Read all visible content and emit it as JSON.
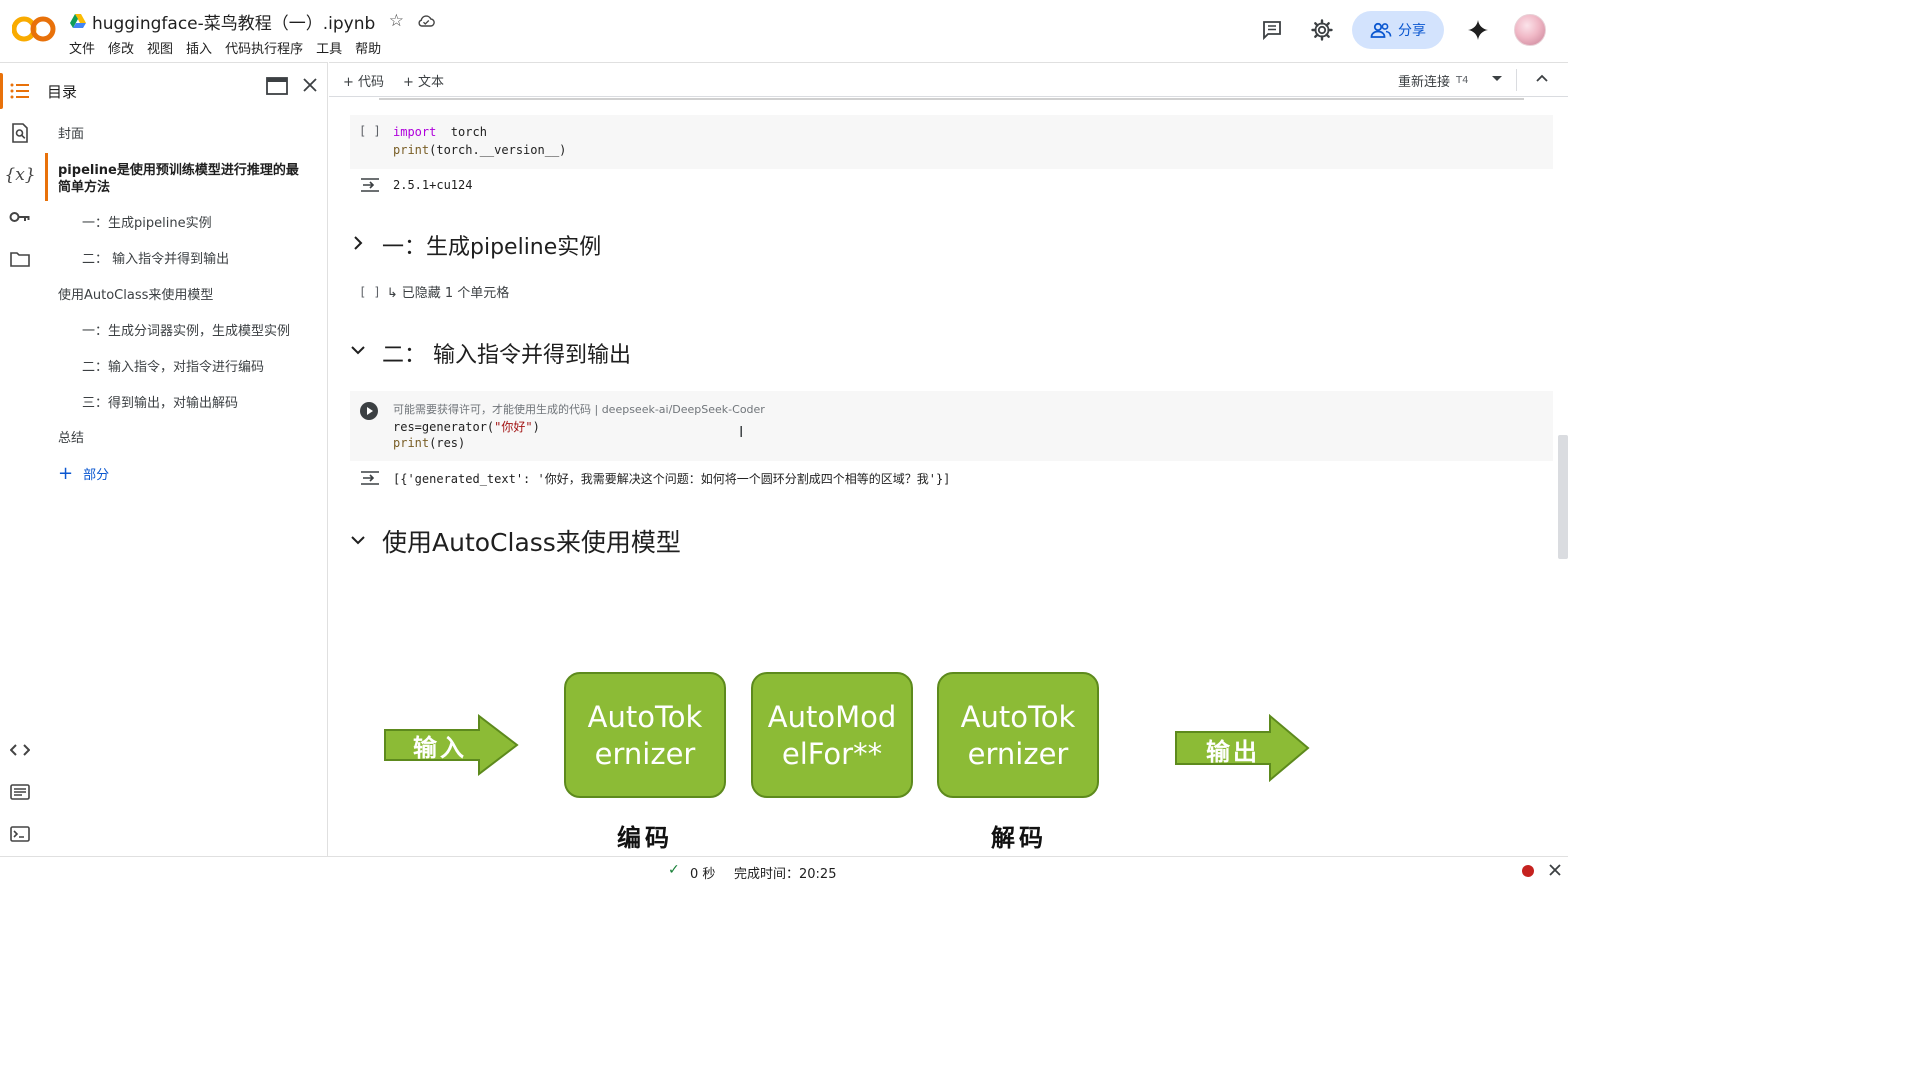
{
  "header": {
    "notebook_title": "huggingface-菜鸟教程（一）.ipynb",
    "menu": [
      "文件",
      "修改",
      "视图",
      "插入",
      "代码执行程序",
      "工具",
      "帮助"
    ],
    "share_label": "分享",
    "logo_text": "CO"
  },
  "toc": {
    "title": "目录",
    "items": [
      {
        "label": "封面"
      },
      {
        "label": "pipeline是使用预训练模型进行推理的最简单方法"
      },
      {
        "label": "一：生成pipeline实例"
      },
      {
        "label": "二： 输入指令并得到输出"
      },
      {
        "label": "使用AutoClass来使用模型"
      },
      {
        "label": "一：生成分词器实例，生成模型实例"
      },
      {
        "label": "二：输入指令，对指令进行编码"
      },
      {
        "label": "三：得到输出，对输出解码"
      },
      {
        "label": "总结"
      }
    ],
    "add_section_label": "部分"
  },
  "toolbar": {
    "add_code_label": "+ 代码",
    "add_text_label": "+ 文本",
    "reconnect_label": "重新连接",
    "runtime_type": "T4"
  },
  "cells": {
    "cell1": {
      "bracket": "[ ]",
      "line1_kw": "import",
      "line1_rest": "  torch",
      "line2_fn": "print",
      "line2_rest": "(torch.__version__)",
      "output": "2.5.1+cu124"
    },
    "heading1": "一：生成pipeline实例",
    "hidden_cells": {
      "bracket": "[ ]",
      "label": "↳ 已隐藏 1 个单元格"
    },
    "heading2": "二： 输入指令并得到输出",
    "cell2": {
      "notice": "可能需要获得许可，才能使用生成的代码 | deepseek-ai/DeepSeek-Coder",
      "line1_pre": "res=generator(",
      "line1_str": "\"你好\"",
      "line1_post": ")",
      "line2_fn": "print",
      "line2_rest": "(res)",
      "output": "[{'generated_text': '你好，我需要解决这个问题：如何将一个圆环分割成四个相等的区域？我'}]"
    },
    "heading3": "使用AutoClass来使用模型"
  },
  "diagram": {
    "input_arrow": "输入",
    "box1": "AutoTok ernizer",
    "box2": "AutoMod elFor**",
    "box3": "AutoTok ernizer",
    "output_arrow": "输出",
    "caption_encode": "编码",
    "caption_decode": "解码"
  },
  "status": {
    "elapsed": "0 秒",
    "completed_at": "完成时间：20:25"
  },
  "colors": {
    "accent_orange": "#e8710a",
    "share_bg": "#d3e3fd",
    "box_green": "#8cbb36",
    "keyword_purple": "#af00db",
    "string_red": "#a31515"
  }
}
